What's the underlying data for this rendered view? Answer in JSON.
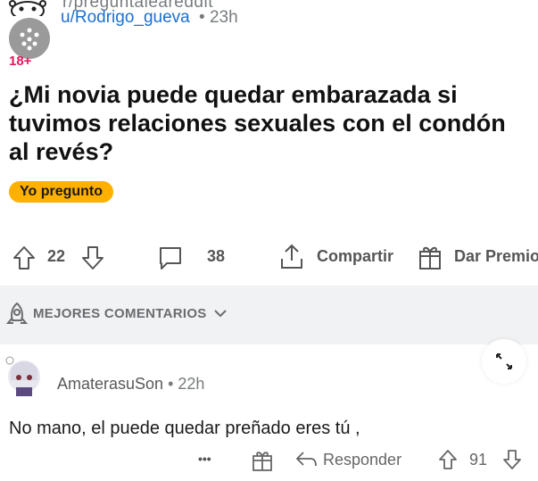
{
  "post": {
    "subreddit_partial": "r/preguntaleareddit",
    "user": "u/Rodrigo_gueva",
    "time": "23h",
    "nsfw": "18+",
    "title": "¿Mi novia puede quedar embarazada si tuvimos relaciones sexuales con el condón al revés?",
    "flair": "Yo pregunto"
  },
  "actions": {
    "upvotes": "22",
    "comments": "38",
    "share": "Compartir",
    "award": "Dar Premio"
  },
  "section": {
    "label": "MEJORES COMENTARIOS"
  },
  "comment": {
    "user": "AmaterasuSon",
    "time": "22h",
    "body": "No mano, el puede quedar preñado eres tú ,",
    "more": "•••",
    "reply": "Responder",
    "votes": "91"
  },
  "colors": {
    "flair": "#ffb000",
    "user_link": "#1a6fd0",
    "nsfw": "#e8155d",
    "section_bg": "#f1f2f4"
  }
}
